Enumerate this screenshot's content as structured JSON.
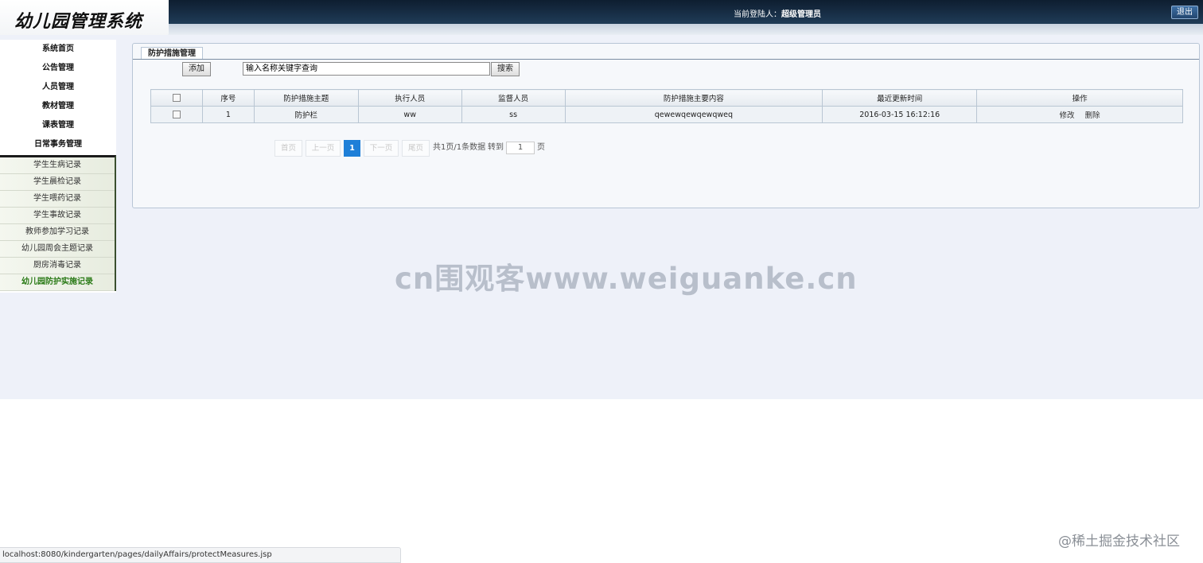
{
  "header": {
    "logo": "幼儿园管理系统",
    "login_label": "当前登陆人：",
    "login_user": "超级管理员",
    "logout_label": "退出"
  },
  "sidebar": {
    "items": [
      {
        "label": "系统首页"
      },
      {
        "label": "公告管理"
      },
      {
        "label": "人员管理"
      },
      {
        "label": "教材管理"
      },
      {
        "label": "课表管理"
      },
      {
        "label": "日常事务管理"
      }
    ],
    "subitems": [
      {
        "label": "学生生病记录"
      },
      {
        "label": "学生晨检记录"
      },
      {
        "label": "学生喂药记录"
      },
      {
        "label": "学生事故记录"
      },
      {
        "label": "教师参加学习记录"
      },
      {
        "label": "幼儿园周会主题记录"
      },
      {
        "label": "厨房消毒记录"
      },
      {
        "label": "幼儿园防护实施记录",
        "active": true
      }
    ]
  },
  "panel": {
    "tab_label": "防护措施管理",
    "add_label": "添加",
    "search_value": "输入名称关键字查询",
    "search_label": "搜索"
  },
  "table": {
    "headers": [
      "",
      "序号",
      "防护措施主题",
      "执行人员",
      "监督人员",
      "防护措施主要内容",
      "最近更新时间",
      "操作"
    ],
    "rows": [
      {
        "index": "1",
        "topic": "防护栏",
        "executor": "ww",
        "supervisor": "ss",
        "content": "qewewqewqewqweq",
        "updated": "2016-03-15 16:12:16",
        "edit": "修改",
        "delete": "删除"
      }
    ]
  },
  "pager": {
    "first": "首页",
    "prev": "上一页",
    "current": "1",
    "next": "下一页",
    "last": "尾页",
    "summary": "共1页/1条数据",
    "goto_label": "转到",
    "goto_value": "1",
    "page_suffix": "页"
  },
  "watermark": "cn围观客www.weiguanke.cn",
  "footer_watermark": "@稀土掘金技术社区",
  "status_url": "localhost:8080/kindergarten/pages/dailyAffairs/protectMeasures.jsp",
  "colors": {
    "header_dark": "#0e1e30",
    "accent_blue": "#1e7fd8",
    "active_menu": "#2a7a17",
    "background": "#eef1f9"
  }
}
